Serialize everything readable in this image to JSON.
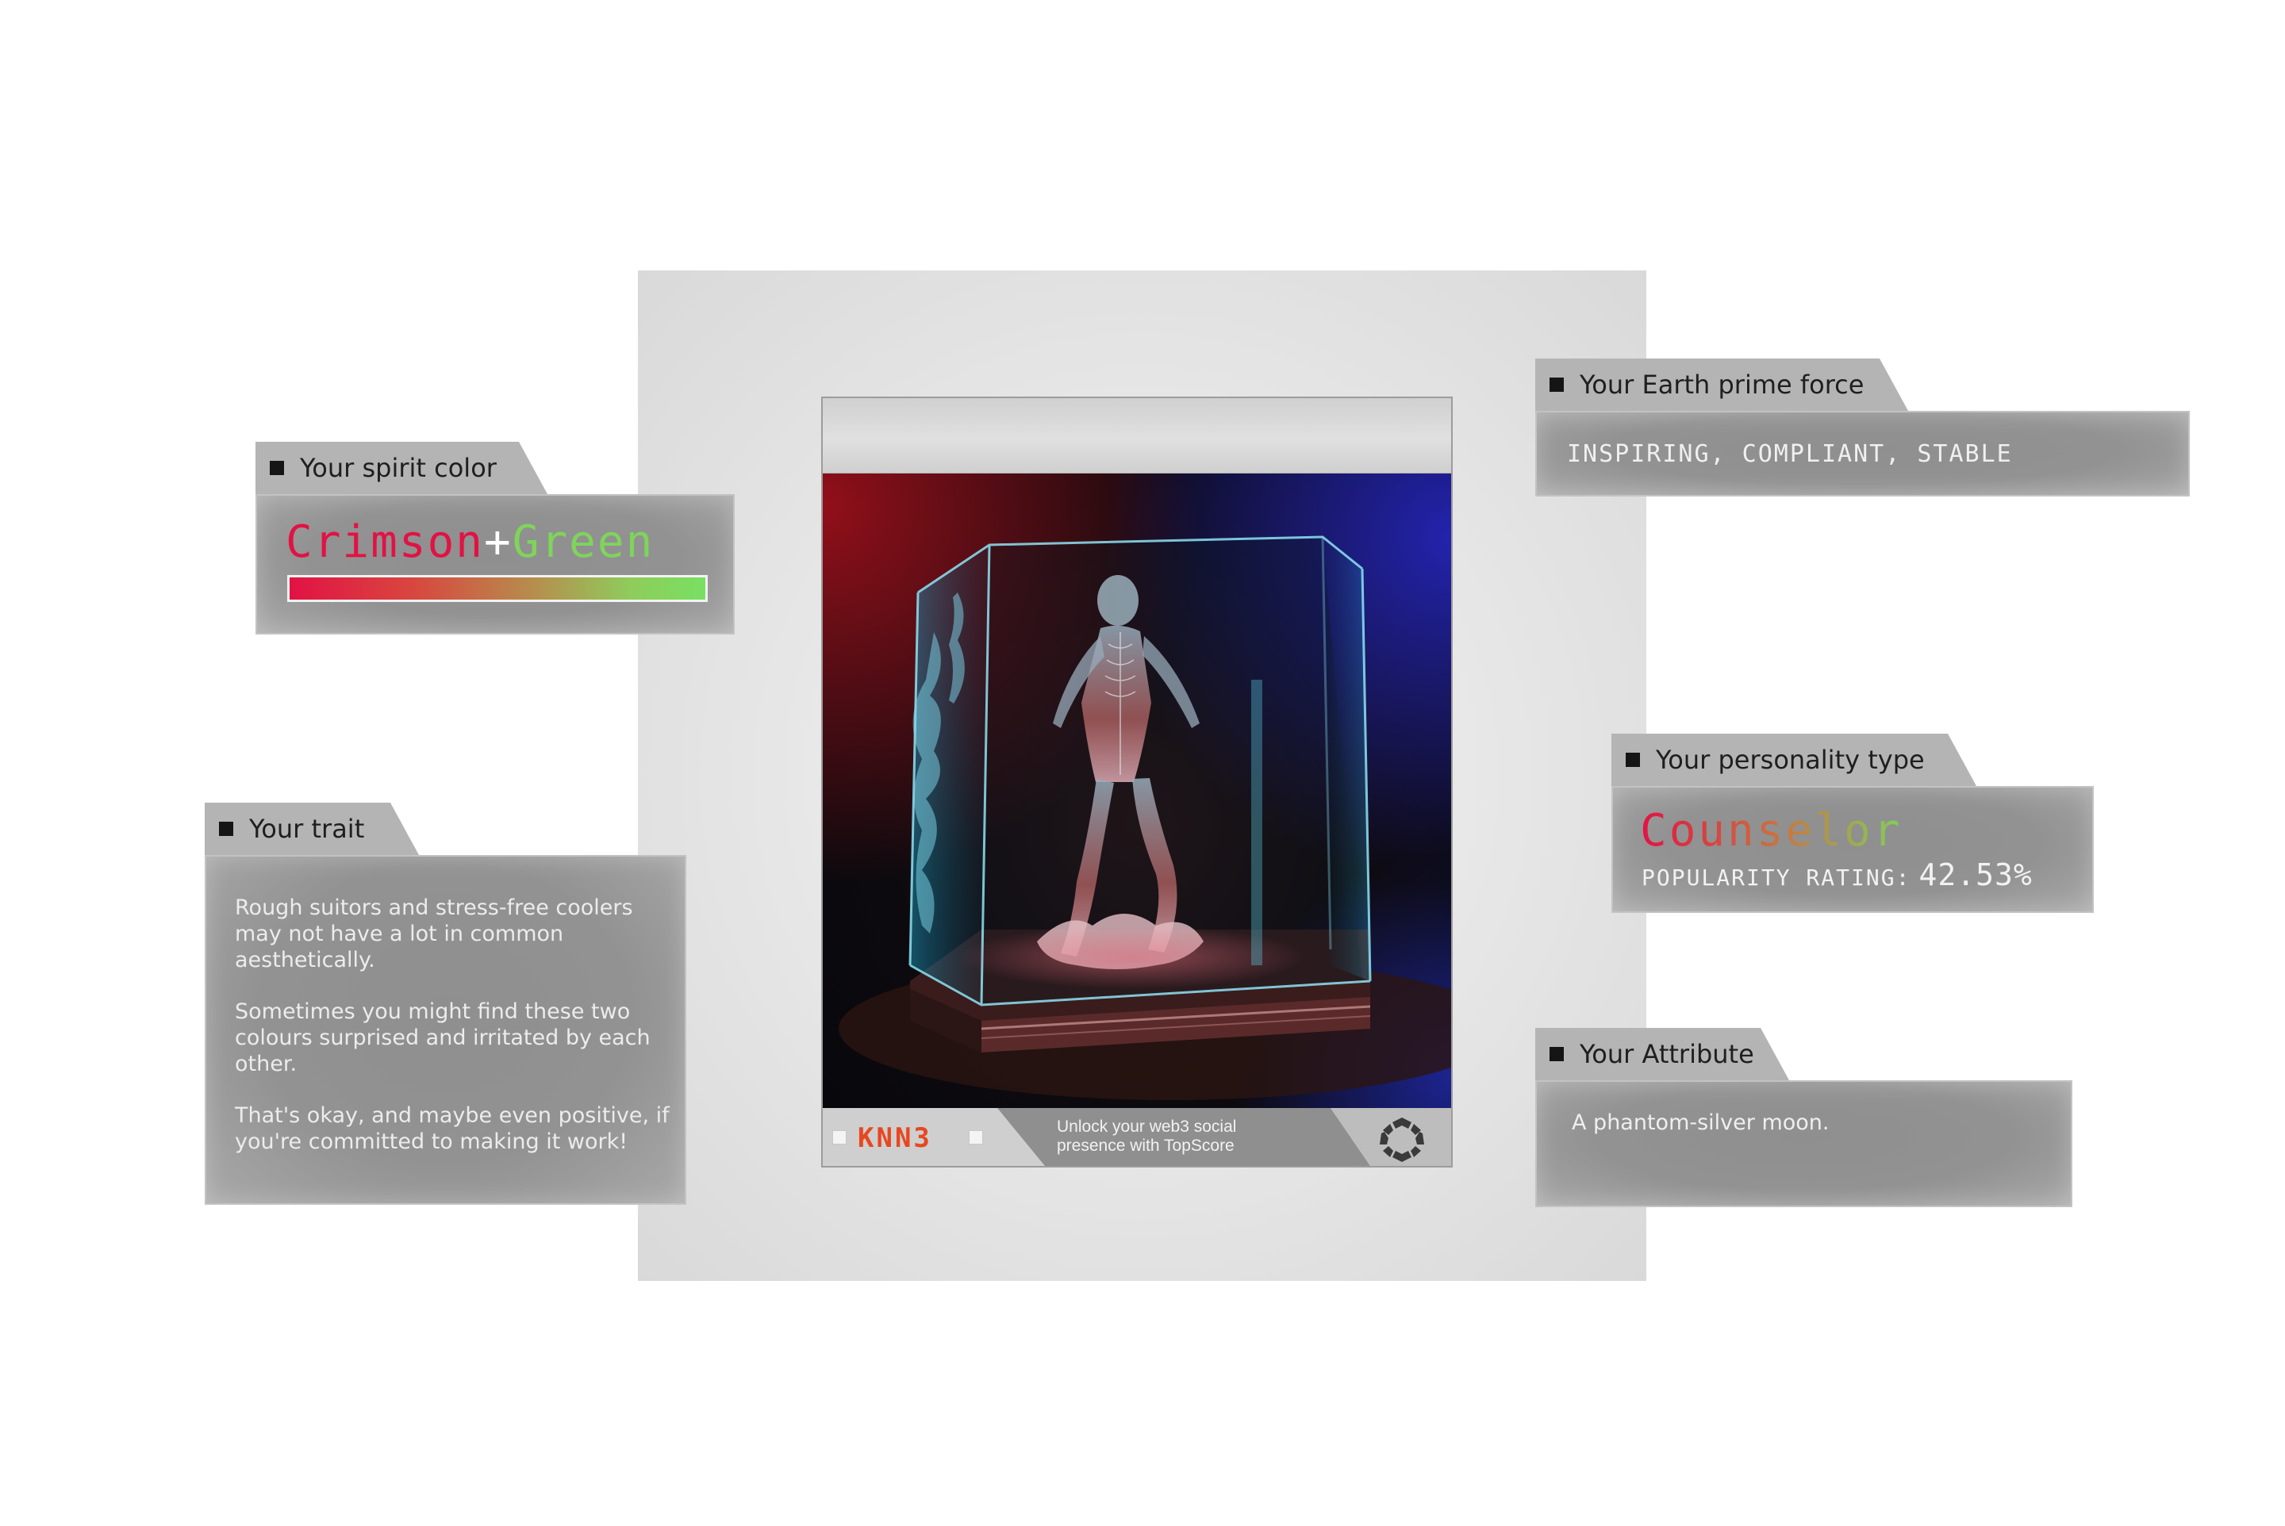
{
  "spirit_color": {
    "header": "Your spirit color",
    "primary": "Crimson",
    "plus": "+",
    "secondary": "Green",
    "primary_color": "#e21244",
    "secondary_color": "#7fd45a"
  },
  "trait": {
    "header": "Your trait",
    "paragraphs": [
      "Rough suitors and stress-free coolers may not have a lot in common aesthetically.",
      "Sometimes you might find these two colours surprised and irritated by each other.",
      "That's okay, and maybe even positive, if you're committed to making it work!"
    ]
  },
  "earth_force": {
    "header": "Your Earth prime force",
    "value": "INSPIRING, COMPLIANT, STABLE"
  },
  "personality": {
    "header": "Your personality type",
    "type": "Counselor",
    "popularity_label": "POPULARITY RATING:",
    "popularity_value": "42.53%"
  },
  "attribute": {
    "header": "Your Attribute",
    "value": "A phantom-silver moon."
  },
  "card": {
    "logo_text": "KNN3",
    "footer_text": "Unlock your web3 social presence with TopScore",
    "image_alt": "Glass figure inside a glass display case",
    "accent_color": "#e8471f"
  }
}
